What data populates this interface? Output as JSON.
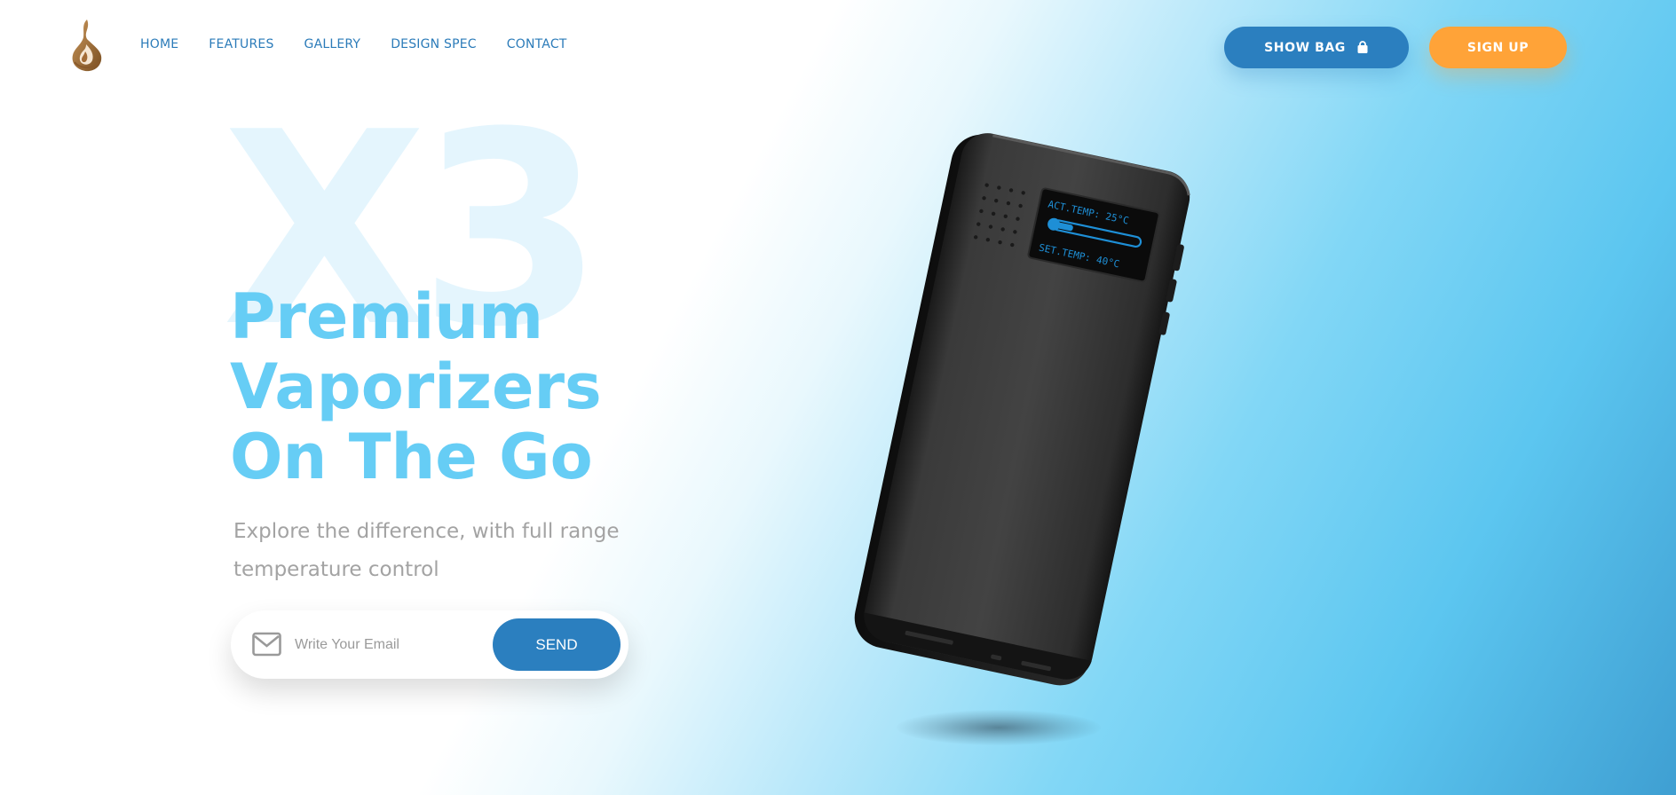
{
  "nav": {
    "items": [
      "HOME",
      "FEATURES",
      "GALLERY",
      "DESIGN SPEC",
      "CONTACT"
    ]
  },
  "header": {
    "show_bag_label": "SHOW BAG",
    "sign_up_label": "SIGN UP"
  },
  "hero": {
    "watermark": "X3",
    "headline_line1": "Premium",
    "headline_line2": "Vaporizers",
    "headline_line3": "On The Go",
    "subtext": "Explore the difference, with full range temperature control"
  },
  "email_form": {
    "placeholder": "Write Your Email",
    "value": "",
    "send_label": "SEND"
  },
  "device_screen": {
    "act_temp": "ACT.TEMP: 25°C",
    "set_temp": "SET.TEMP: 40°C"
  },
  "colors": {
    "primary_blue": "#2b7fbf",
    "accent_orange": "#ffa338",
    "headline_blue": "#66cdf5",
    "screen_cyan": "#1e8fd6"
  },
  "icons": {
    "logo": "flame-drop-logo",
    "bag": "shopping-bag-icon",
    "mail": "envelope-icon"
  }
}
